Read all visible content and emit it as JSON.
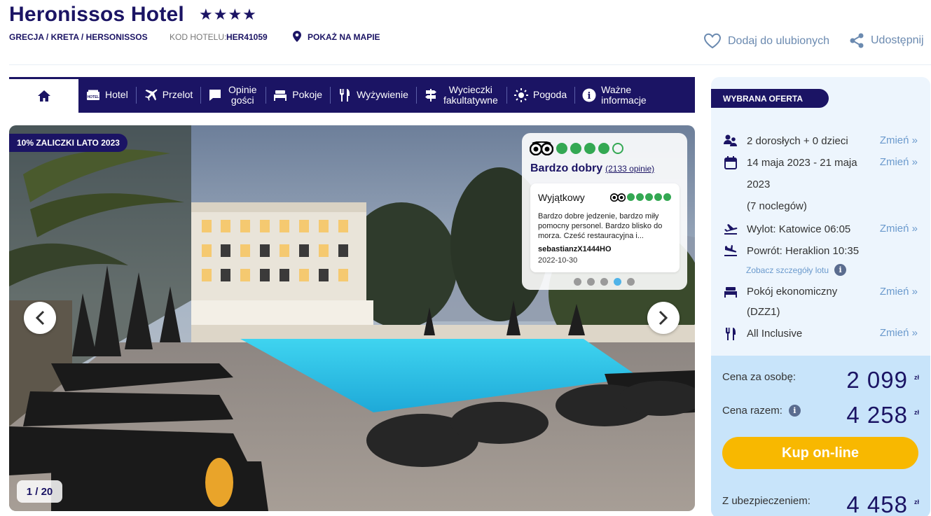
{
  "header": {
    "title": "Heronissos Hotel",
    "stars": "★★★★",
    "breadcrumb": "GRECJA / KRETA / HERSONISSOS",
    "code_label": "KOD HOTELU:",
    "code_value": "HER41059",
    "map_link": "POKAŻ NA MAPIE",
    "favorite": "Dodaj do ulubionych",
    "share": "Udostępnij"
  },
  "nav": {
    "items": [
      {
        "label": "Hotel",
        "icon": "hotel-icon"
      },
      {
        "label": "Przelot",
        "icon": "plane-icon"
      },
      {
        "label": "Opinie gości",
        "icon": "chat-icon"
      },
      {
        "label": "Pokoje",
        "icon": "bed-icon"
      },
      {
        "label": "Wyżywienie",
        "icon": "cutlery-icon"
      },
      {
        "label": "Wycieczki fakultatywne",
        "icon": "signpost-icon"
      },
      {
        "label": "Pogoda",
        "icon": "sun-icon"
      },
      {
        "label": "Ważne informacje",
        "icon": "info-icon"
      }
    ]
  },
  "gallery": {
    "promo": "10% ZALICZKI LATO 2023",
    "counter": "1 / 20",
    "tripadvisor": {
      "rating_text": "Bardzo dobry",
      "reviews_count": "(2133 opinie)",
      "bubbles": 4,
      "review": {
        "title": "Wyjątkowy",
        "bubbles": 5,
        "text": "Bardzo dobre jedzenie, bardzo miły pomocny personel. Bardzo blisko do morza. Cześć restauracyjna i...",
        "author": "sebastianzX1444HO",
        "date": "2022-10-30"
      },
      "carousel_active_index": 3,
      "carousel_total": 5
    }
  },
  "offer": {
    "badge": "WYBRANA OFERTA",
    "change_label": "Zmień »",
    "guests": "2 dorosłych + 0 dzieci",
    "dates_line1": "14 maja 2023 - 21 maja",
    "dates_line2": "2023",
    "nights": "(7 noclegów)",
    "departure": "Wylot: Katowice 06:05",
    "return": "Powrót: Heraklion 10:35",
    "flight_details": "Zobacz szczegóły lotu",
    "room_line1": "Pokój ekonomiczny",
    "room_line2": "(DZZ1)",
    "board": "All Inclusive",
    "price_per_person_label": "Cena za osobę:",
    "price_per_person": "2 099",
    "total_label": "Cena razem:",
    "total": "4 258",
    "currency": "zł",
    "buy_button": "Kup on-line",
    "insurance_label": "Z ubezpieczeniem:",
    "insurance_total": "4 458"
  },
  "colors": {
    "brand": "#1b1464",
    "accent": "#f8b800",
    "link": "#6b9acd",
    "tripadvisor": "#34a853"
  }
}
